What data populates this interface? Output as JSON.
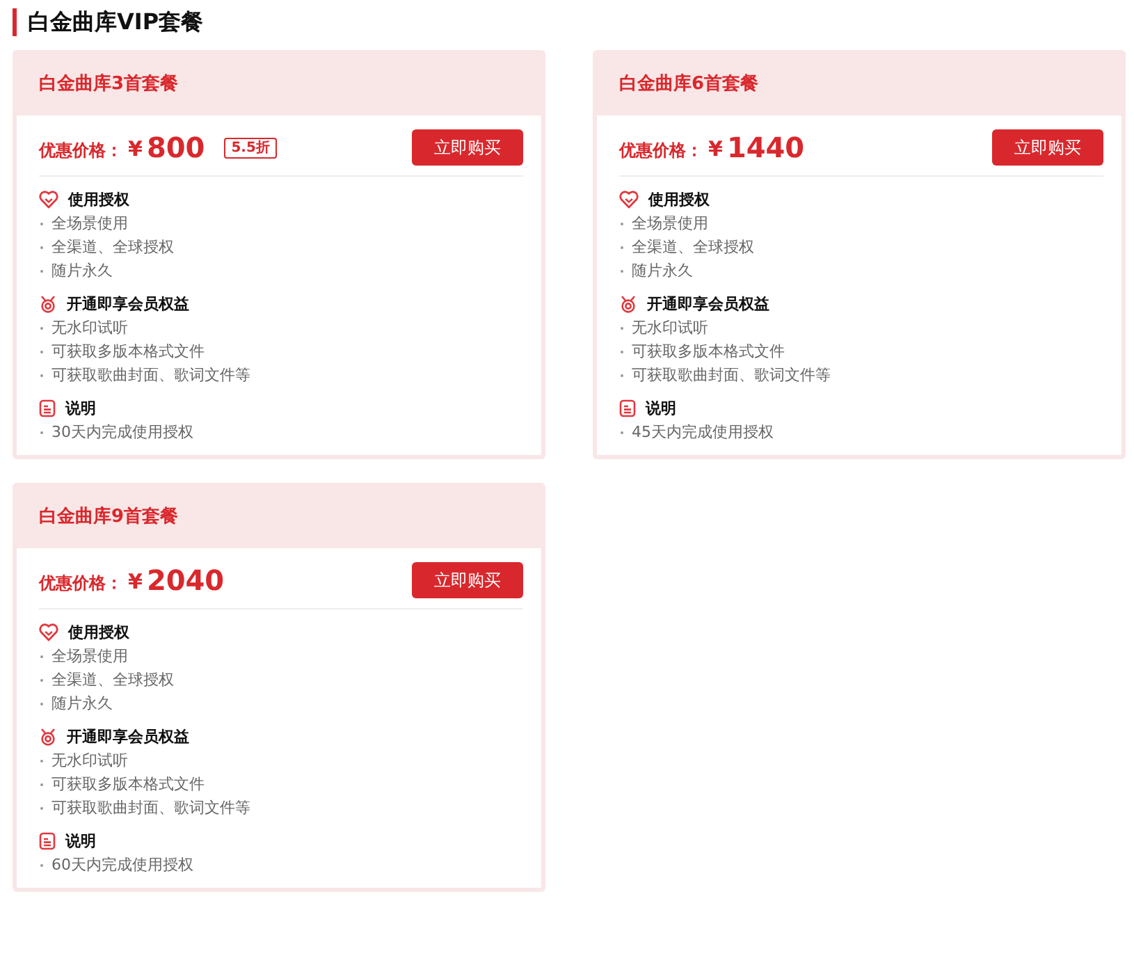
{
  "title": "白金曲库VIP套餐",
  "packages": [
    {
      "name": "白金曲库3首套餐",
      "price_label": "优惠价格：",
      "currency": "¥",
      "price": "800",
      "discount": "5.5折",
      "button": "立即购买",
      "sections": [
        {
          "kind": "license",
          "heading": "使用授权",
          "items": [
            "全场景使用",
            "全渠道、全球授权",
            "随片永久"
          ]
        },
        {
          "kind": "member",
          "heading": "开通即享会员权益",
          "items": [
            "无水印试听",
            "可获取多版本格式文件",
            "可获取歌曲封面、歌词文件等"
          ]
        },
        {
          "kind": "note",
          "heading": "说明",
          "items": [
            "30天内完成使用授权"
          ]
        }
      ]
    },
    {
      "name": "白金曲库6首套餐",
      "price_label": "优惠价格：",
      "currency": "¥",
      "price": "1440",
      "button": "立即购买",
      "sections": [
        {
          "kind": "license",
          "heading": "使用授权",
          "items": [
            "全场景使用",
            "全渠道、全球授权",
            "随片永久"
          ]
        },
        {
          "kind": "member",
          "heading": "开通即享会员权益",
          "items": [
            "无水印试听",
            "可获取多版本格式文件",
            "可获取歌曲封面、歌词文件等"
          ]
        },
        {
          "kind": "note",
          "heading": "说明",
          "items": [
            "45天内完成使用授权"
          ]
        }
      ]
    },
    {
      "name": "白金曲库9首套餐",
      "price_label": "优惠价格：",
      "currency": "¥",
      "price": "2040",
      "button": "立即购买",
      "sections": [
        {
          "kind": "license",
          "heading": "使用授权",
          "items": [
            "全场景使用",
            "全渠道、全球授权",
            "随片永久"
          ]
        },
        {
          "kind": "member",
          "heading": "开通即享会员权益",
          "items": [
            "无水印试听",
            "可获取多版本格式文件",
            "可获取歌曲封面、歌词文件等"
          ]
        },
        {
          "kind": "note",
          "heading": "说明",
          "items": [
            "60天内完成使用授权"
          ]
        }
      ]
    }
  ]
}
